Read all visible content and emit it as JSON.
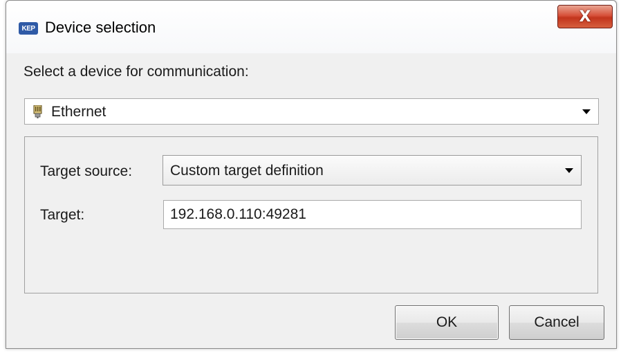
{
  "window": {
    "title": "Device selection",
    "close_glyph": "X",
    "app_icon": "kepware-logo-icon"
  },
  "main": {
    "select_device_label": "Select a device for communication:",
    "device_combo": {
      "value": "Ethernet",
      "icon": "ethernet-plug-icon"
    },
    "target_source": {
      "label": "Target source:",
      "value": "Custom target definition"
    },
    "target": {
      "label": "Target:",
      "value": "192.168.0.110:49281"
    }
  },
  "buttons": {
    "ok": "OK",
    "cancel": "Cancel"
  },
  "colors": {
    "close_button": "#c9432b",
    "window_bg": "#f0f0f0"
  }
}
